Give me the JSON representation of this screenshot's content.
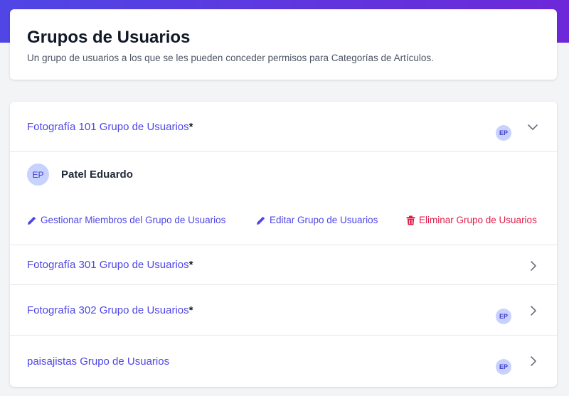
{
  "header": {
    "title": "Grupos de Usuarios",
    "subtitle": "Un grupo de usuarios a los que se les pueden conceder permisos para Categorías de Artículos."
  },
  "groups": [
    {
      "name": "Fotografía 101 Grupo de Usuarios",
      "marker": "*",
      "badge": "EP",
      "expanded": true
    },
    {
      "name": "Fotografía 301 Grupo de Usuarios",
      "marker": "*",
      "badge": "",
      "expanded": false
    },
    {
      "name": "Fotografía 302 Grupo de Usuarios",
      "marker": "*",
      "badge": "EP",
      "expanded": false
    },
    {
      "name": "paisajistas Grupo de Usuarios",
      "marker": "",
      "badge": "EP",
      "expanded": false
    }
  ],
  "expanded_group": {
    "member": {
      "initials": "EP",
      "name": "Patel Eduardo"
    },
    "actions": {
      "manage": "Gestionar Miembros del Grupo de Usuarios",
      "edit": "Editar Grupo de Usuarios",
      "delete": "Eliminar Grupo de Usuarios"
    }
  },
  "colors": {
    "accent": "#4f46e5",
    "danger": "#e11d48",
    "badge_bg": "#c7d2fe"
  },
  "icons": {
    "collapse": "chevron-down-icon",
    "expand": "chevron-right-icon",
    "edit": "pencil-icon",
    "delete": "trash-icon"
  }
}
